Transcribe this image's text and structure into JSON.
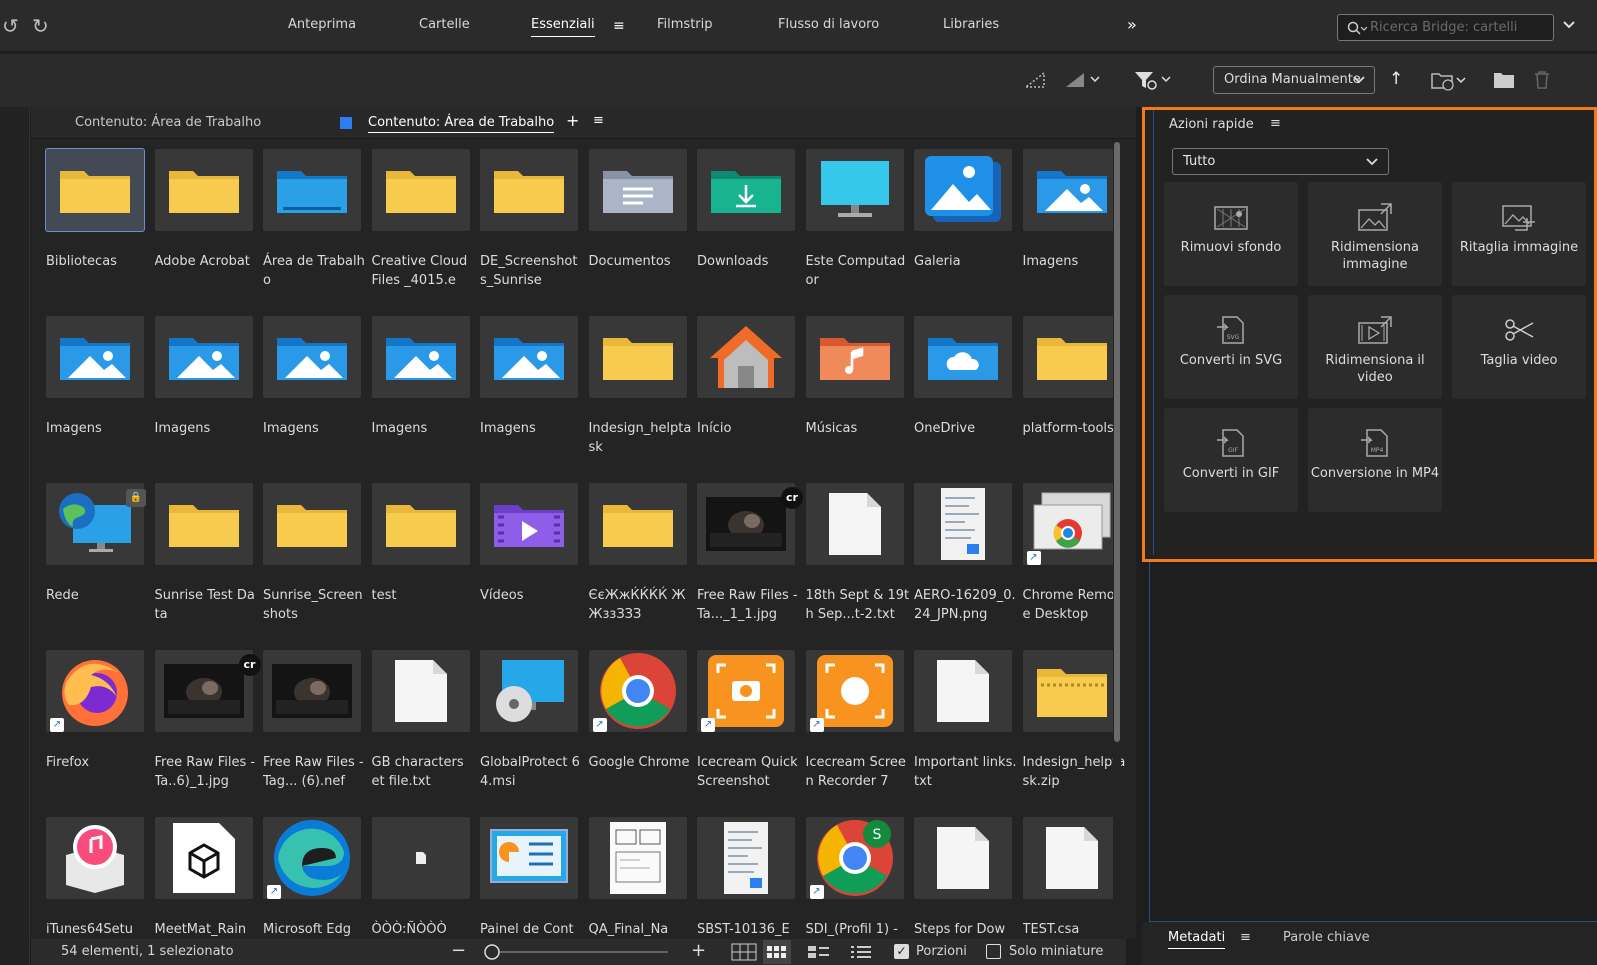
{
  "nav": {
    "tabs": [
      "Anteprima",
      "Cartelle",
      "Essenziali",
      "Filmstrip",
      "Flusso di lavoro",
      "Libraries"
    ],
    "active": "Essenziali"
  },
  "search": {
    "placeholder": "Ricerca Bridge: cartelli"
  },
  "toolbar": {
    "sort_label": "Ordina Manualmente"
  },
  "content": {
    "tab1": "Contenuto: Área de Trabalho",
    "tab2": "Contenuto: Área de Trabalho"
  },
  "items": [
    {
      "label": "Bibliotecas",
      "icon": "folder-icon",
      "selected": true
    },
    {
      "label": "Adobe Acrobat",
      "icon": "folder-icon"
    },
    {
      "label": "Área de Trabalho",
      "icon": "desktop-folder-icon"
    },
    {
      "label": "Creative Cloud Files _4015.e",
      "icon": "folder-icon"
    },
    {
      "label": "DE_Screenshots_Sunrise",
      "icon": "folder-icon"
    },
    {
      "label": "Documentos",
      "icon": "documents-folder-icon"
    },
    {
      "label": "Downloads",
      "icon": "downloads-folder-icon"
    },
    {
      "label": "Este Computador",
      "icon": "monitor-icon"
    },
    {
      "label": "Galeria",
      "icon": "gallery-icon"
    },
    {
      "label": "Imagens",
      "icon": "pictures-folder-icon"
    },
    {
      "label": "Imagens",
      "icon": "pictures-folder-icon"
    },
    {
      "label": "Imagens",
      "icon": "pictures-folder-icon"
    },
    {
      "label": "Imagens",
      "icon": "pictures-folder-icon"
    },
    {
      "label": "Imagens",
      "icon": "pictures-folder-icon"
    },
    {
      "label": "Imagens",
      "icon": "pictures-folder-icon"
    },
    {
      "label": "Indesign_helptask",
      "icon": "folder-icon"
    },
    {
      "label": "Início",
      "icon": "home-icon"
    },
    {
      "label": "Músicas",
      "icon": "music-folder-icon"
    },
    {
      "label": "OneDrive",
      "icon": "onedrive-folder-icon"
    },
    {
      "label": "platform-tools",
      "icon": "folder-icon"
    },
    {
      "label": "Rede",
      "icon": "network-icon",
      "lock": true
    },
    {
      "label": "Sunrise Test Data",
      "icon": "folder-icon"
    },
    {
      "label": "Sunrise_Screenshots",
      "icon": "folder-icon"
    },
    {
      "label": "test",
      "icon": "folder-icon"
    },
    {
      "label": "Vídeos",
      "icon": "videos-folder-icon"
    },
    {
      "label": "ЄєЖжЌЌЌЌ ЖЖззЗЗЗ",
      "icon": "folder-icon"
    },
    {
      "label": "Free Raw Files - Ta..._1_1.jpg",
      "icon": "photo-icon",
      "badge": "cr"
    },
    {
      "label": "18th Sept & 19th Sep...t-2.txt",
      "icon": "text-file-icon"
    },
    {
      "label": "AERO-16209_0.24_JPN.png",
      "icon": "screenshot-icon"
    },
    {
      "label": "Chrome Remote Desktop",
      "icon": "chrome-remote-icon",
      "shortcut": true
    },
    {
      "label": "Firefox",
      "icon": "firefox-icon",
      "shortcut": true
    },
    {
      "label": "Free Raw Files - Ta..6)_1.jpg",
      "icon": "photo-icon",
      "badge": "cr"
    },
    {
      "label": "Free Raw Files - Tag... (6).nef",
      "icon": "photo-icon"
    },
    {
      "label": "GB characters et file.txt",
      "icon": "text-file-icon"
    },
    {
      "label": "GlobalProtect 64.msi",
      "icon": "installer-icon"
    },
    {
      "label": "Google Chrome",
      "icon": "chrome-icon",
      "shortcut": true
    },
    {
      "label": "Icecream Quick Screenshot",
      "icon": "icecream-screenshot-icon",
      "shortcut": true
    },
    {
      "label": "Icecream Screen Recorder 7",
      "icon": "icecream-recorder-icon",
      "shortcut": true
    },
    {
      "label": "Important links.txt",
      "icon": "text-file-icon"
    },
    {
      "label": "Indesign_helptask.zip",
      "icon": "zip-folder-icon"
    },
    {
      "label": "iTunes64Setu",
      "icon": "itunes-installer-icon"
    },
    {
      "label": "MeetMat_Rain",
      "icon": "3d-file-icon"
    },
    {
      "label": "Microsoft Edg",
      "icon": "edge-icon",
      "shortcut": true
    },
    {
      "label": "ÒÒÒ:ÑÒÒÒ",
      "icon": "blank-icon"
    },
    {
      "label": "Painel de Cont",
      "icon": "control-panel-icon"
    },
    {
      "label": "QA_Final_Na",
      "icon": "document-page-icon"
    },
    {
      "label": "SBST-10136_E",
      "icon": "screenshot-icon"
    },
    {
      "label": "SDI_(Profil 1) -",
      "icon": "chrome-profile-icon",
      "shortcut": true
    },
    {
      "label": "Steps for Dow",
      "icon": "text-file-icon"
    },
    {
      "label": "TEST.csa",
      "icon": "text-file-icon"
    }
  ],
  "status": {
    "count": "54 elementi, 1 selezionato",
    "portions": "Porzioni",
    "thumbs_only": "Solo miniature"
  },
  "quick_actions": {
    "title": "Azioni rapide",
    "filter": "Tutto",
    "actions": [
      {
        "label": "Rimuovi sfondo",
        "icon": "remove-bg-icon"
      },
      {
        "label": "Ridimensiona immagine",
        "icon": "resize-image-icon"
      },
      {
        "label": "Ritaglia immagine",
        "icon": "crop-image-icon"
      },
      {
        "label": "Converti in SVG",
        "icon": "svg-file-icon"
      },
      {
        "label": "Ridimensiona il video",
        "icon": "resize-video-icon"
      },
      {
        "label": "Taglia video",
        "icon": "scissors-icon"
      },
      {
        "label": "Converti in GIF",
        "icon": "gif-file-icon"
      },
      {
        "label": "Conversione in MP4",
        "icon": "mp4-file-icon"
      }
    ]
  },
  "meta": {
    "tab1": "Metadati",
    "tab2": "Parole chiave"
  },
  "colors": {
    "accent_orange": "#f07b1c",
    "folder": "#f6c443",
    "selection": "#6a8dc8"
  }
}
